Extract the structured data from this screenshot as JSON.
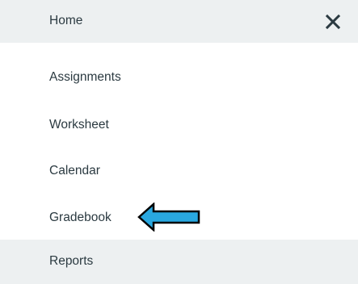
{
  "menu": {
    "items": [
      {
        "id": "home",
        "label": "Home"
      },
      {
        "id": "assignments",
        "label": "Assignments"
      },
      {
        "id": "worksheet",
        "label": "Worksheet"
      },
      {
        "id": "calendar",
        "label": "Calendar"
      },
      {
        "id": "gradebook",
        "label": "Gradebook"
      },
      {
        "id": "reports",
        "label": "Reports"
      }
    ],
    "close_icon": "close-icon"
  },
  "annotation": {
    "icon": "left-arrow-icon",
    "fill_color": "#29a8e0",
    "stroke_color": "#000000"
  },
  "colors": {
    "highlight_bg": "#edf0f1",
    "text": "#2b3a41"
  }
}
